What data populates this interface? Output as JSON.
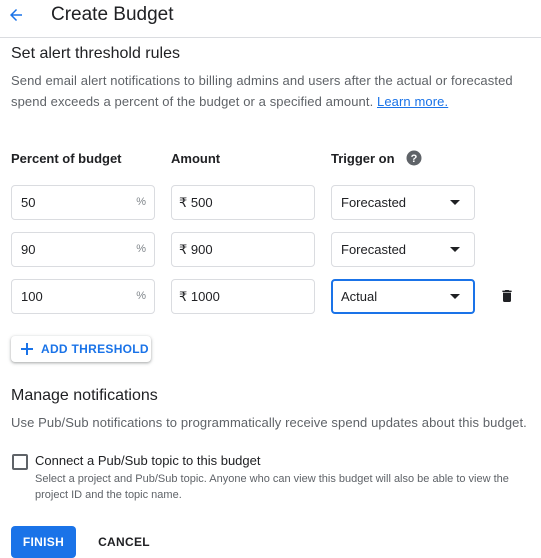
{
  "header": {
    "title": "Create Budget"
  },
  "alert_section": {
    "title": "Set alert threshold rules",
    "description": "Send email alert notifications to billing admins and users after the actual or forecasted spend exceeds a percent of the budget or a specified amount. ",
    "learn_more": "Learn more."
  },
  "columns": {
    "percent": "Percent of budget",
    "amount": "Amount",
    "trigger": "Trigger on"
  },
  "thresholds": [
    {
      "percent": "50",
      "percent_suffix": "%",
      "amount": "₹ 500",
      "trigger": "Forecasted"
    },
    {
      "percent": "90",
      "percent_suffix": "%",
      "amount": "₹ 900",
      "trigger": "Forecasted"
    },
    {
      "percent": "100",
      "percent_suffix": "%",
      "amount": "₹ 1000",
      "trigger": "Actual"
    }
  ],
  "add_threshold": {
    "label": "ADD THRESHOLD"
  },
  "notifications": {
    "title": "Manage notifications",
    "description": "Use Pub/Sub notifications to programmatically receive spend updates about this budget.",
    "checkbox_label": "Connect a Pub/Sub topic to this budget",
    "checkbox_checked": false,
    "checkbox_help": "Select a project and Pub/Sub topic. Anyone who can view this budget will also be able to view the project ID and the topic name."
  },
  "actions": {
    "finish": "FINISH",
    "cancel": "CANCEL"
  },
  "colors": {
    "accent": "#1a73e8",
    "text": "#202124",
    "secondary_text": "#5f6368",
    "border": "#dadce0"
  }
}
